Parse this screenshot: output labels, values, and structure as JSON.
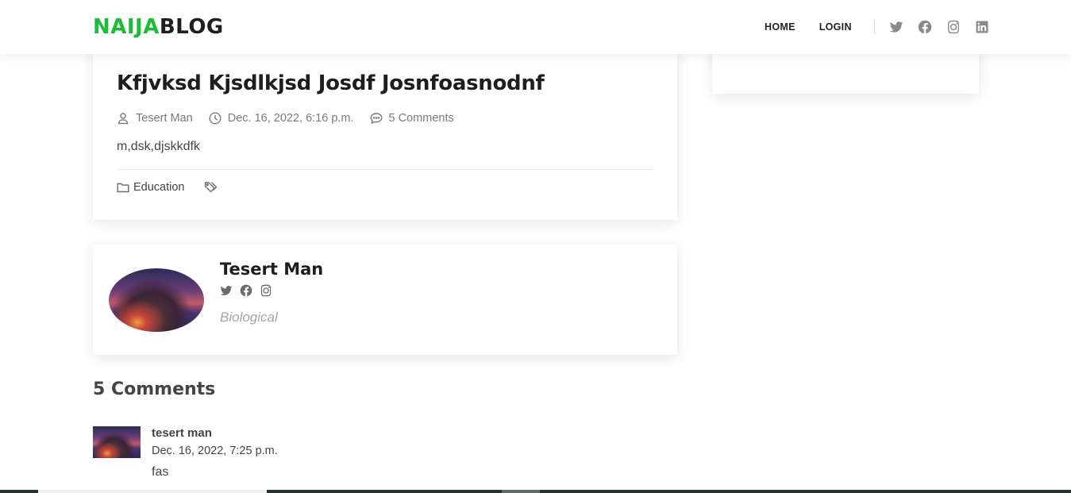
{
  "header": {
    "logo_part1": "NAIJA",
    "logo_part2": "BLOG",
    "nav": {
      "home": "HOME",
      "login": "LOGIN"
    },
    "social_icons": [
      "twitter-icon",
      "facebook-icon",
      "instagram-icon",
      "linkedin-icon"
    ],
    "accent_color": "#1bbd36"
  },
  "post": {
    "title": "Kfjvksd Kjsdlkjsd Josdf Josnfoasnodnf",
    "author": "Tesert Man",
    "date": "Dec. 16, 2022, 6:16 p.m.",
    "comments_count": "5 Comments",
    "excerpt": "m,dsk,djskkdfk",
    "category": "Education",
    "tags": []
  },
  "author_card": {
    "name": "Tesert Man",
    "bio": "Biological",
    "social_icons": [
      "twitter-icon",
      "facebook-icon",
      "instagram-icon"
    ]
  },
  "comments": {
    "title": "5 Comments",
    "items": [
      {
        "author": "tesert man",
        "date": "Dec. 16, 2022, 7:25 p.m.",
        "body": "fas"
      }
    ]
  }
}
